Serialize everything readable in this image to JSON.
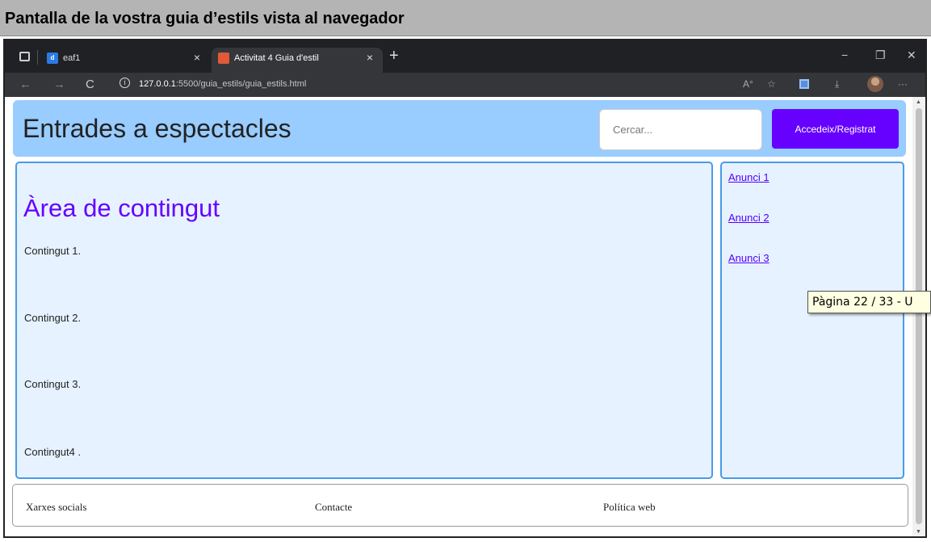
{
  "doc_title": "Pantalla de la vostra guia d’estils vista al navegador",
  "browser": {
    "tabs": [
      {
        "label": "eaf1",
        "favicon": "d",
        "active": false
      },
      {
        "label": "Activitat 4 Guia d'estil",
        "favicon": "",
        "active": true
      }
    ],
    "tab_close": "×",
    "new_tab": "+",
    "window_controls": {
      "minimize": "−",
      "restore": "❐",
      "close": "✕"
    },
    "url_host": "127.0.0.1",
    "url_rest": ":5500/guia_estils/guia_estils.html",
    "nav_icons": {
      "back": "←",
      "forward": "→",
      "reload": "C"
    },
    "toolbar_icons": {
      "read_aloud": "A°",
      "favorites": "☆",
      "downloads": "⤓",
      "more": "···"
    }
  },
  "site": {
    "title": "Entrades a espectacles",
    "search_placeholder": "Cercar...",
    "login_button": "Accedeix/Registrat",
    "content": {
      "heading": "Àrea de contingut",
      "paragraphs": [
        "Contingut 1.",
        "Contingut 2.",
        "Contingut 3.",
        "Contingut4 ."
      ]
    },
    "ads": [
      "Anunci 1",
      "Anunci 2",
      "Anunci 3"
    ],
    "footer": [
      "Xarxes socials",
      "Contacte",
      "Política web"
    ]
  },
  "tooltip": "Pàgina  22 / 33  - U",
  "colors": {
    "header_bg": "#99ccff",
    "accent": "#6600ff",
    "panel_bg": "#e6f2ff",
    "panel_border": "#4a9ae8",
    "chrome_dark": "#202124"
  }
}
